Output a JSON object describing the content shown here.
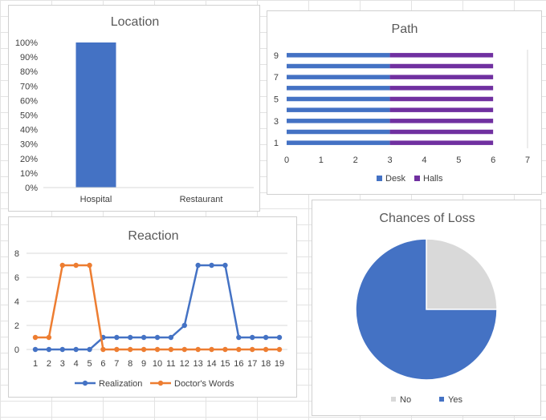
{
  "colors": {
    "blue": "#4472C4",
    "orange": "#ED7D31",
    "purple": "#7030A0",
    "gray": "#D9D9D9",
    "grid": "#D9D9D9",
    "text": "#595959"
  },
  "chart_data": [
    {
      "type": "bar",
      "title": "Location",
      "categories": [
        "Hospital",
        "Restaurant"
      ],
      "values": [
        1.0,
        0.0
      ],
      "ylim": [
        0,
        1
      ],
      "yticks": [
        "0%",
        "10%",
        "20%",
        "30%",
        "40%",
        "50%",
        "60%",
        "70%",
        "80%",
        "90%",
        "100%"
      ],
      "grid": false
    },
    {
      "type": "bar",
      "orientation": "horizontal",
      "stacked": true,
      "title": "Path",
      "categories": [
        "1",
        "2",
        "3",
        "4",
        "5",
        "6",
        "7",
        "8",
        "9"
      ],
      "category_tick_labels": [
        "1",
        "3",
        "5",
        "7",
        "9"
      ],
      "series": [
        {
          "name": "Desk",
          "values": [
            3,
            3,
            3,
            3,
            3,
            3,
            3,
            3,
            3
          ]
        },
        {
          "name": "Halls",
          "values": [
            3,
            3,
            3,
            3,
            3,
            3,
            3,
            3,
            3
          ]
        }
      ],
      "xlim": [
        0,
        7
      ],
      "xticks": [
        "0",
        "1",
        "2",
        "3",
        "4",
        "5",
        "6",
        "7"
      ],
      "legend": "bottom"
    },
    {
      "type": "line",
      "title": "Reaction",
      "x": [
        "1",
        "2",
        "3",
        "4",
        "5",
        "6",
        "7",
        "8",
        "9",
        "10",
        "11",
        "12",
        "13",
        "14",
        "15",
        "16",
        "17",
        "18",
        "19"
      ],
      "series": [
        {
          "name": "Realization",
          "values": [
            0,
            0,
            0,
            0,
            0,
            1,
            1,
            1,
            1,
            1,
            1,
            2,
            7,
            7,
            7,
            1,
            1,
            1,
            1
          ]
        },
        {
          "name": "Doctor's Words",
          "values": [
            1,
            1,
            7,
            7,
            7,
            0,
            0,
            0,
            0,
            0,
            0,
            0,
            0,
            0,
            0,
            0,
            0,
            0,
            0
          ]
        }
      ],
      "ylim": [
        0,
        8
      ],
      "yticks": [
        "0",
        "2",
        "4",
        "6",
        "8"
      ],
      "grid": true,
      "legend": "bottom"
    },
    {
      "type": "pie",
      "title": "Chances of Loss",
      "categories": [
        "No",
        "Yes"
      ],
      "values": [
        25,
        75
      ],
      "legend": "bottom"
    }
  ]
}
